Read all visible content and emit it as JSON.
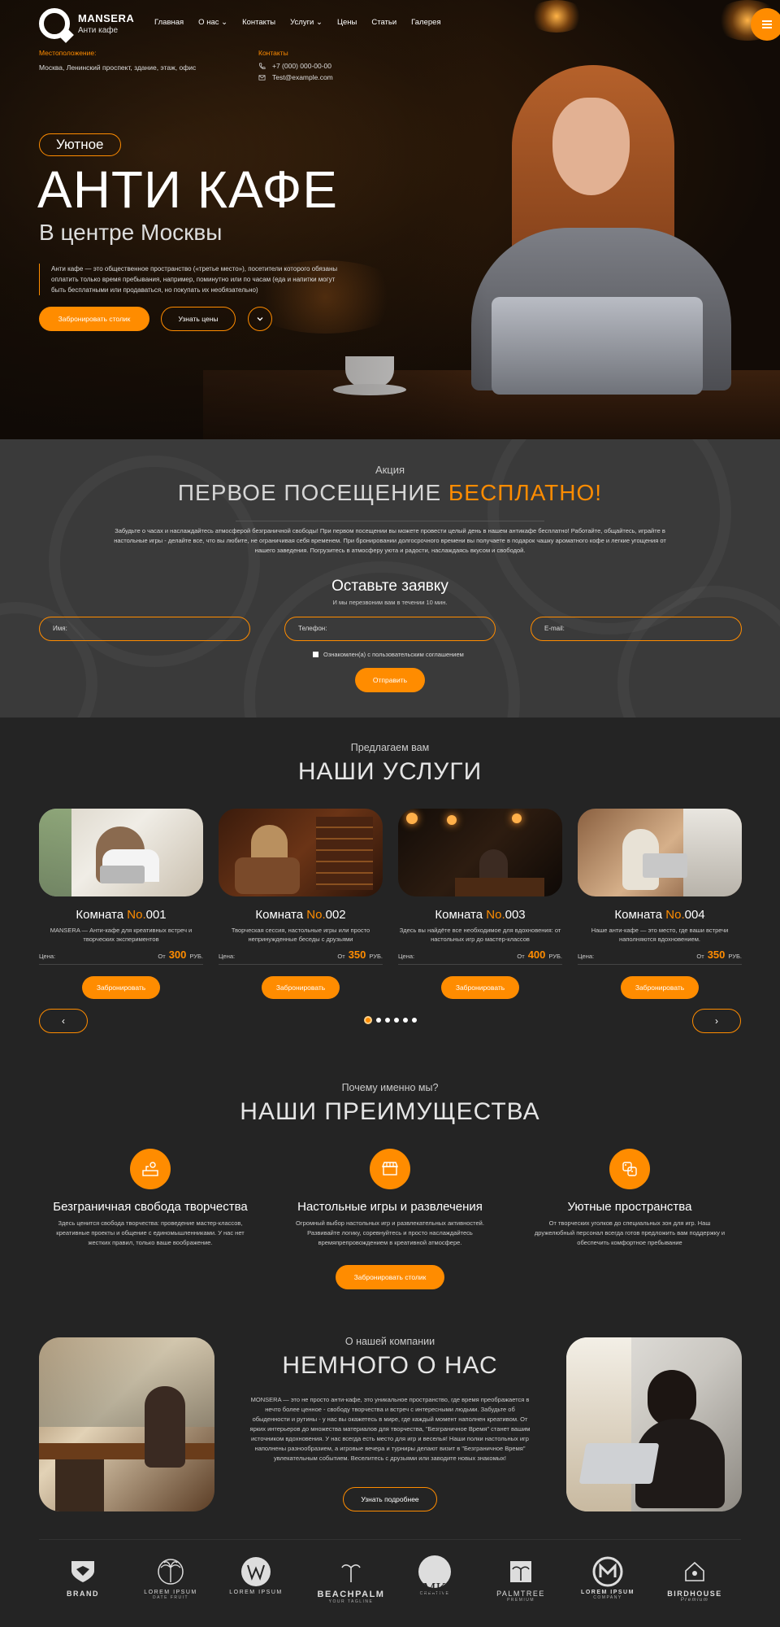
{
  "header": {
    "logo_name": "MANSERA",
    "logo_sub": "Анти кафе",
    "nav": [
      "Главная",
      "О нас",
      "Контакты",
      "Услуги",
      "Цены",
      "Статьи",
      "Галерея"
    ],
    "location_label": "Местоположение:",
    "location_value": "Москва, Ленинский проспект, здание, этаж, офис",
    "contacts_label": "Контакты",
    "phone": "+7 (000) 000-00-00",
    "email": "Test@example.com"
  },
  "hero": {
    "tag": "Уютное",
    "title": "АНТИ КАФЕ",
    "subtitle": "В центре Москвы",
    "description": "Анти кафе — это общественное пространство («третье место»), посетители которого обязаны оплатить только время пребывания, например, поминутно или по часам (еда и напитки могут быть бесплатными или продаваться, но покупать их необязательно)",
    "book_button": "Забронировать столик",
    "prices_button": "Узнать цены"
  },
  "promo": {
    "kicker": "Акция",
    "title_main": "ПЕРВОЕ ПОСЕЩЕНИЕ",
    "title_accent": "БЕСПЛАТНО!",
    "text": "Забудьте о часах и наслаждайтесь атмосферой безграничной свободы! При первом посещении вы можете провести целый день в нашем антикафе бесплатно! Работайте, общайтесь, играйте в настольные игры - делайте все, что вы любите, не ограничивая себя временем. При бронировании долгосрочного времени вы получаете в подарок чашку ароматного кофе и легкие угощения от нашего заведения. Погрузитесь в атмосферу уюта и радости, наслаждаясь вкусом и свободой.",
    "form_title": "Оставьте заявку",
    "form_sub": "И мы перезвоним вам в течении 10 мин.",
    "name_placeholder": "Имя:",
    "phone_placeholder": "Телефон:",
    "email_placeholder": "E-mail:",
    "consent": "Ознакомлен(а) с пользовательским соглашением",
    "submit": "Отправить"
  },
  "services": {
    "kicker": "Предлагаем вам",
    "title": "НАШИ УСЛУГИ",
    "price_label": "Цена:",
    "from": "От",
    "currency": "РУБ.",
    "book": "Забронировать",
    "prev": "‹",
    "next": "›",
    "cards": [
      {
        "room": "Комната ",
        "no": "No.",
        "num": "001",
        "desc": "MANSERA — Анти-кафе для креативных встреч и творческих экспериментов",
        "price": "300"
      },
      {
        "room": "Комната ",
        "no": "No.",
        "num": "002",
        "desc": "Творческая сессия, настольные игры или просто непринужденные беседы с друзьями",
        "price": "350"
      },
      {
        "room": "Комната ",
        "no": "No.",
        "num": "003",
        "desc": "Здесь вы найдёте все необходимое для вдохновения: от настольных игр до мастер-классов",
        "price": "400"
      },
      {
        "room": "Комната ",
        "no": "No.",
        "num": "004",
        "desc": "Наше анти-кафе — это место, где ваши встречи наполняются вдохновением.",
        "price": "350"
      }
    ]
  },
  "advantages": {
    "kicker": "Почему именно мы?",
    "title": "НАШИ ПРЕИМУЩЕСТВА",
    "items": [
      {
        "title": "Безграничная свобода творчества",
        "desc": "Здесь ценится свобода творчества: проведение мастер-классов, креативные проекты и общение с единомышленниками. У нас нет жестких правил, только ваше воображение."
      },
      {
        "title": "Настольные игры и развлечения",
        "desc": "Огромный выбор настольных игр и развлекательных активностей. Развивайте логику, соревнуйтесь и просто наслаждайтесь времяпрепровождением в креативной атмосфере."
      },
      {
        "title": "Уютные пространства",
        "desc": "От творческих уголков до специальных зон для игр. Наш дружелюбный персонал всегда готов предложить вам поддержку и обеспечить комфортное пребывание"
      }
    ],
    "button": "Забронировать столик"
  },
  "about": {
    "kicker": "О нашей компании",
    "title": "НЕМНОГО О НАС",
    "text": "MONSERA — это не просто анти-кафе, это уникальное пространство, где время преображается в нечто более ценное - свободу творчества и встреч с интересными людьми. Забудьте об обыденности и рутины - у нас вы окажетесь в мире, где каждый момент наполнен креативом. От ярких интерьеров до множества материалов для творчества, \"Безграничное Время\" станет вашим источником вдохновения. У нас всегда есть место для игр и веселья! Наши полки настольных игр наполнены разнообразием, а игровые вечера и турниры делают визит в \"Безграничное Время\" увлекательным событием. Веселитесь с друзьями или заводите новых знакомых!",
    "button": "Узнать подробнее"
  },
  "brands": [
    {
      "name": "BRAND",
      "sub": ""
    },
    {
      "name": "LOREM IPSUM",
      "sub": "DATE FRUIT"
    },
    {
      "name": "LOREM IPSUM",
      "sub": ""
    },
    {
      "name": "BEACHPALM",
      "sub": "YOUR TAGLINE"
    },
    {
      "name": "MK",
      "sub": "CREATIVE"
    },
    {
      "name": "PALMTREE",
      "sub": "PREMIUM"
    },
    {
      "name": "LOREM IPSUM",
      "sub": "COMPANY"
    },
    {
      "name": "BIRDHOUSE",
      "sub": "Premium"
    }
  ],
  "colors": {
    "accent": "#ff8c00",
    "background": "#242424",
    "promo_bg": "#3a3a3a"
  }
}
